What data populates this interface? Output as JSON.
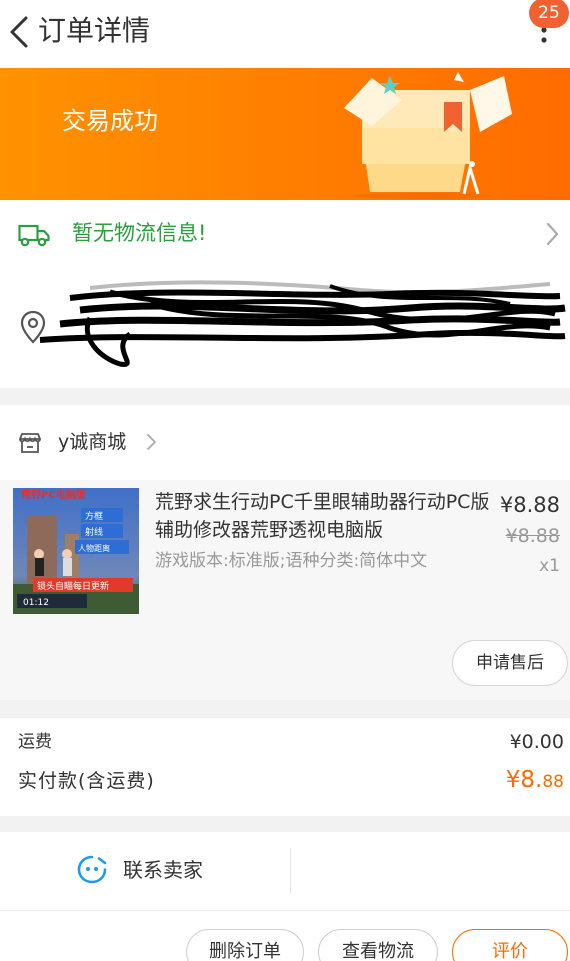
{
  "header": {
    "title": "订单详情",
    "badge_count": "25"
  },
  "status": {
    "text": "交易成功"
  },
  "logistics": {
    "text": "暂无物流信息!"
  },
  "store": {
    "name": "y诚商城"
  },
  "product": {
    "title": "荒野求生行动PC千里眼辅助器行动PC版辅助修改器荒野透视电脑版",
    "spec": "游戏版本:标准版;语种分类:简体中文",
    "price": "¥8.88",
    "original_price": "¥8.88",
    "quantity": "x1",
    "thumb_title": "荒野PC电脑版",
    "thumb_tags": [
      "方框",
      "射线",
      "人物距离"
    ],
    "thumb_caption": "锁头自瞄每日更新",
    "thumb_time": "01:12"
  },
  "actions": {
    "aftersale": "申请售后",
    "delete_order": "删除订单",
    "view_logistics": "查看物流",
    "review": "评价"
  },
  "fees": {
    "shipping_label": "运费",
    "shipping_value": "¥0.00",
    "total_label": "实付款(含运费)",
    "total_main": "¥8.",
    "total_cents": "88"
  },
  "contact": {
    "label": "联系卖家"
  },
  "colors": {
    "accent": "#ff6a00",
    "banner": "#ff8a00",
    "logistics_green": "#2aa03c",
    "badge": "#f0622f"
  },
  "icons": {
    "back": "chevron-left-icon",
    "more": "more-vertical-icon",
    "truck": "truck-icon",
    "location": "location-icon",
    "store": "store-icon",
    "chat": "chat-icon"
  }
}
